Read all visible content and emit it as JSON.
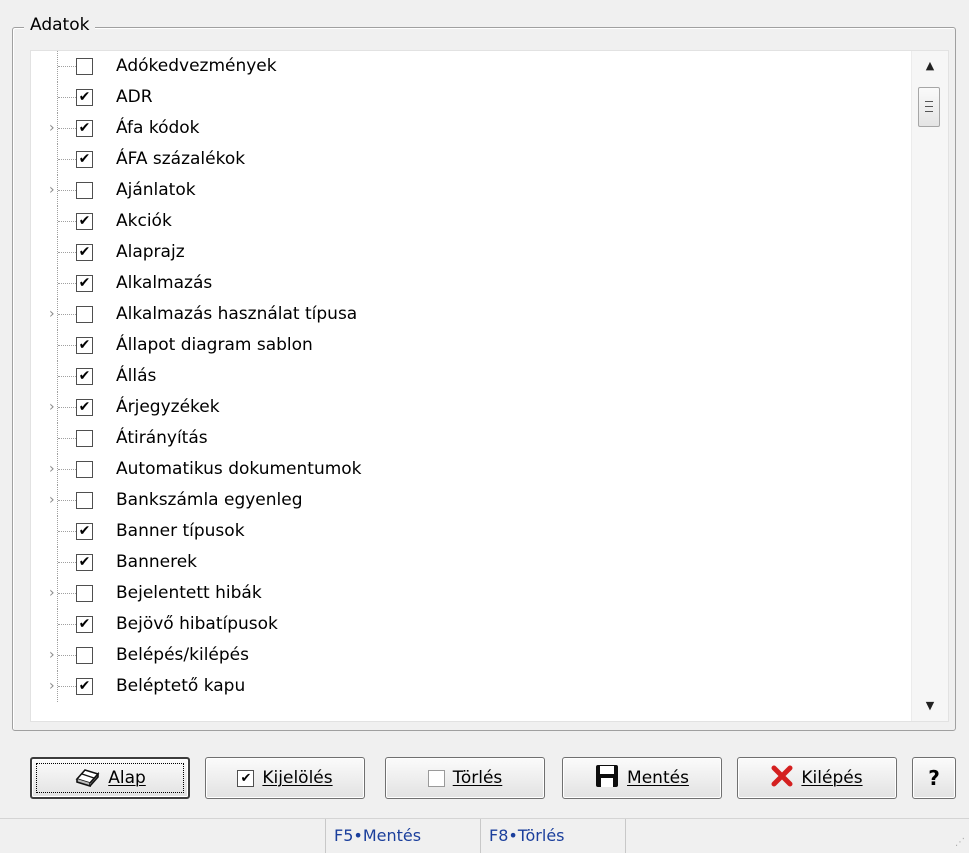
{
  "group": {
    "title": "Adatok"
  },
  "tree": {
    "items": [
      {
        "label": "Adókedvezmények",
        "checked": false,
        "expandable": false
      },
      {
        "label": "ADR",
        "checked": true,
        "expandable": false
      },
      {
        "label": "Áfa kódok",
        "checked": true,
        "expandable": true
      },
      {
        "label": "ÁFA százalékok",
        "checked": true,
        "expandable": false
      },
      {
        "label": "Ajánlatok",
        "checked": false,
        "expandable": true
      },
      {
        "label": "Akciók",
        "checked": true,
        "expandable": false
      },
      {
        "label": "Alaprajz",
        "checked": true,
        "expandable": false
      },
      {
        "label": "Alkalmazás",
        "checked": true,
        "expandable": false
      },
      {
        "label": "Alkalmazás használat típusa",
        "checked": false,
        "expandable": true
      },
      {
        "label": "Állapot diagram sablon",
        "checked": true,
        "expandable": false
      },
      {
        "label": "Állás",
        "checked": true,
        "expandable": false
      },
      {
        "label": "Árjegyzékek",
        "checked": true,
        "expandable": true
      },
      {
        "label": "Átirányítás",
        "checked": false,
        "expandable": false
      },
      {
        "label": "Automatikus dokumentumok",
        "checked": false,
        "expandable": true
      },
      {
        "label": "Bankszámla egyenleg",
        "checked": false,
        "expandable": true
      },
      {
        "label": "Banner típusok",
        "checked": true,
        "expandable": false
      },
      {
        "label": "Bannerek",
        "checked": true,
        "expandable": false
      },
      {
        "label": "Bejelentett hibák",
        "checked": false,
        "expandable": true
      },
      {
        "label": "Bejövő hibatípusok",
        "checked": true,
        "expandable": false
      },
      {
        "label": "Belépés/kilépés",
        "checked": false,
        "expandable": true
      },
      {
        "label": "Beléptető kapu",
        "checked": true,
        "expandable": true
      }
    ]
  },
  "buttons": {
    "alap": "Alap",
    "kijeloles": "Kijelölés",
    "torles": "Törlés",
    "mentes": "Mentés",
    "kilepes": "Kilépés",
    "help": "?"
  },
  "icons": {
    "alap": "eraser-icon",
    "kijeloles": "checked-box-icon",
    "torles": "empty-box-icon",
    "mentes": "floppy-disk-icon",
    "kilepes": "red-x-icon"
  },
  "status": {
    "save_hint": "F5•Mentés",
    "delete_hint": "F8•Törlés"
  },
  "colors": {
    "status_text": "#1b3f9c",
    "exit_icon": "#d42020"
  }
}
